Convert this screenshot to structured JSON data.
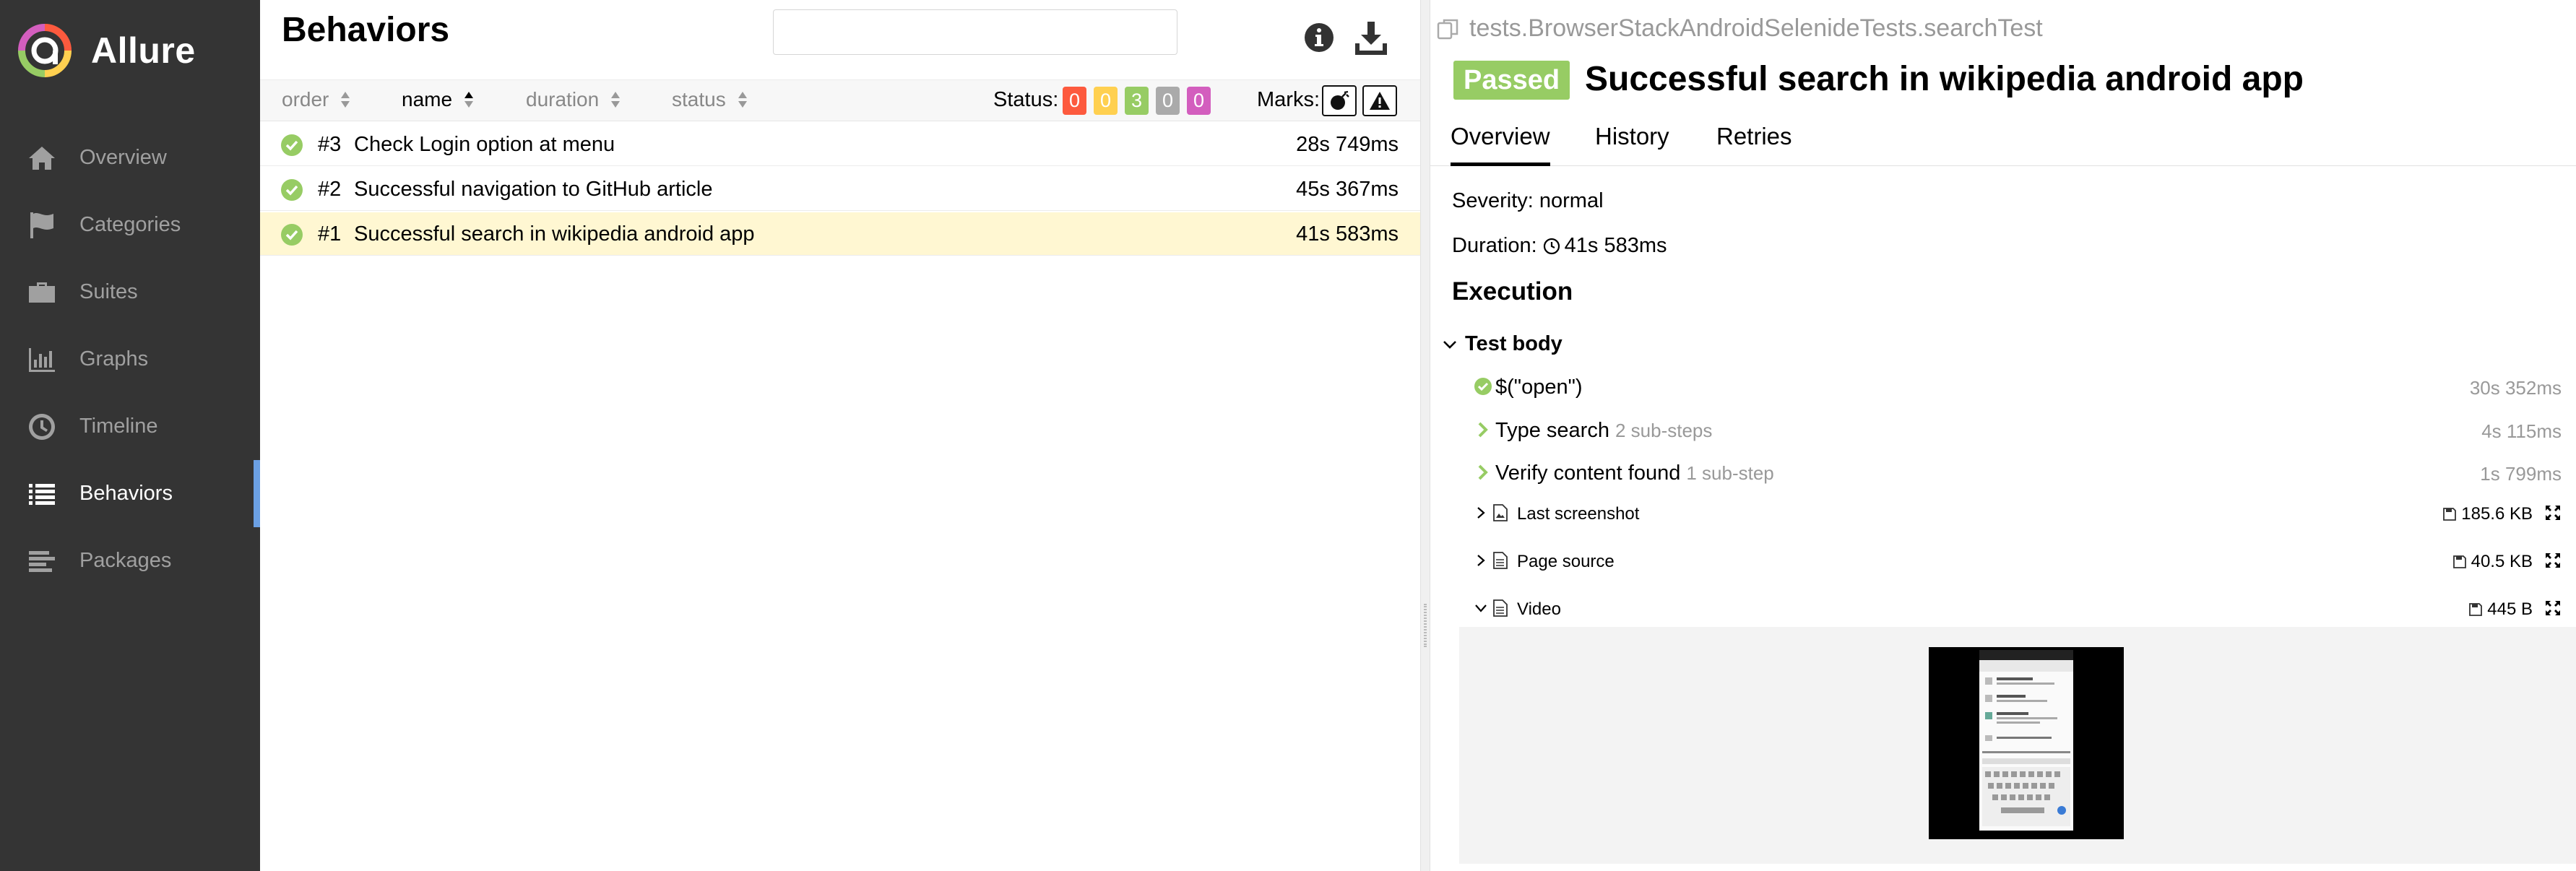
{
  "sidebar": {
    "brand": "Allure",
    "items": [
      {
        "label": "Overview",
        "icon": "home-icon"
      },
      {
        "label": "Categories",
        "icon": "flag-icon"
      },
      {
        "label": "Suites",
        "icon": "briefcase-icon"
      },
      {
        "label": "Graphs",
        "icon": "bar-chart-icon"
      },
      {
        "label": "Timeline",
        "icon": "clock-icon"
      },
      {
        "label": "Behaviors",
        "icon": "list-icon",
        "active": true
      },
      {
        "label": "Packages",
        "icon": "packages-icon"
      }
    ]
  },
  "list": {
    "title": "Behaviors",
    "search_value": "",
    "columns": {
      "order": "order",
      "name": "name",
      "duration": "duration",
      "status": "status"
    },
    "status_label": "Status:",
    "status_counts": [
      {
        "value": "0",
        "color": "#fd5a3e"
      },
      {
        "value": "0",
        "color": "#ffd050"
      },
      {
        "value": "3",
        "color": "#97cc64"
      },
      {
        "value": "0",
        "color": "#aaaaaa"
      },
      {
        "value": "0",
        "color": "#d35ebe"
      }
    ],
    "marks_label": "Marks:",
    "rows": [
      {
        "num": "#3",
        "name": "Check Login option at menu",
        "duration": "28s 749ms"
      },
      {
        "num": "#2",
        "name": "Successful navigation to GitHub article",
        "duration": "45s 367ms"
      },
      {
        "num": "#1",
        "name": "Successful search in wikipedia android app",
        "duration": "41s 583ms",
        "selected": true
      }
    ]
  },
  "detail": {
    "path": "tests.BrowserStackAndroidSelenideTests.searchTest",
    "status": "Passed",
    "status_color": "#97cc64",
    "title": "Successful search in wikipedia android app",
    "tabs": [
      "Overview",
      "History",
      "Retries"
    ],
    "severity": "Severity: normal",
    "duration_label": "Duration:",
    "duration_value": "41s 583ms",
    "execution_title": "Execution",
    "test_body": "Test body",
    "steps": [
      {
        "label": "$(\"open\")",
        "sub": "",
        "time": "30s 352ms"
      },
      {
        "label": "Type search",
        "sub": "2 sub-steps",
        "time": "4s 115ms"
      },
      {
        "label": "Verify content found",
        "sub": "1 sub-step",
        "time": "1s 799ms"
      }
    ],
    "attachments": [
      {
        "name": "Last screenshot",
        "size": "185.6 KB"
      },
      {
        "name": "Page source",
        "size": "40.5 KB"
      },
      {
        "name": "Video",
        "size": "445 B"
      }
    ]
  }
}
